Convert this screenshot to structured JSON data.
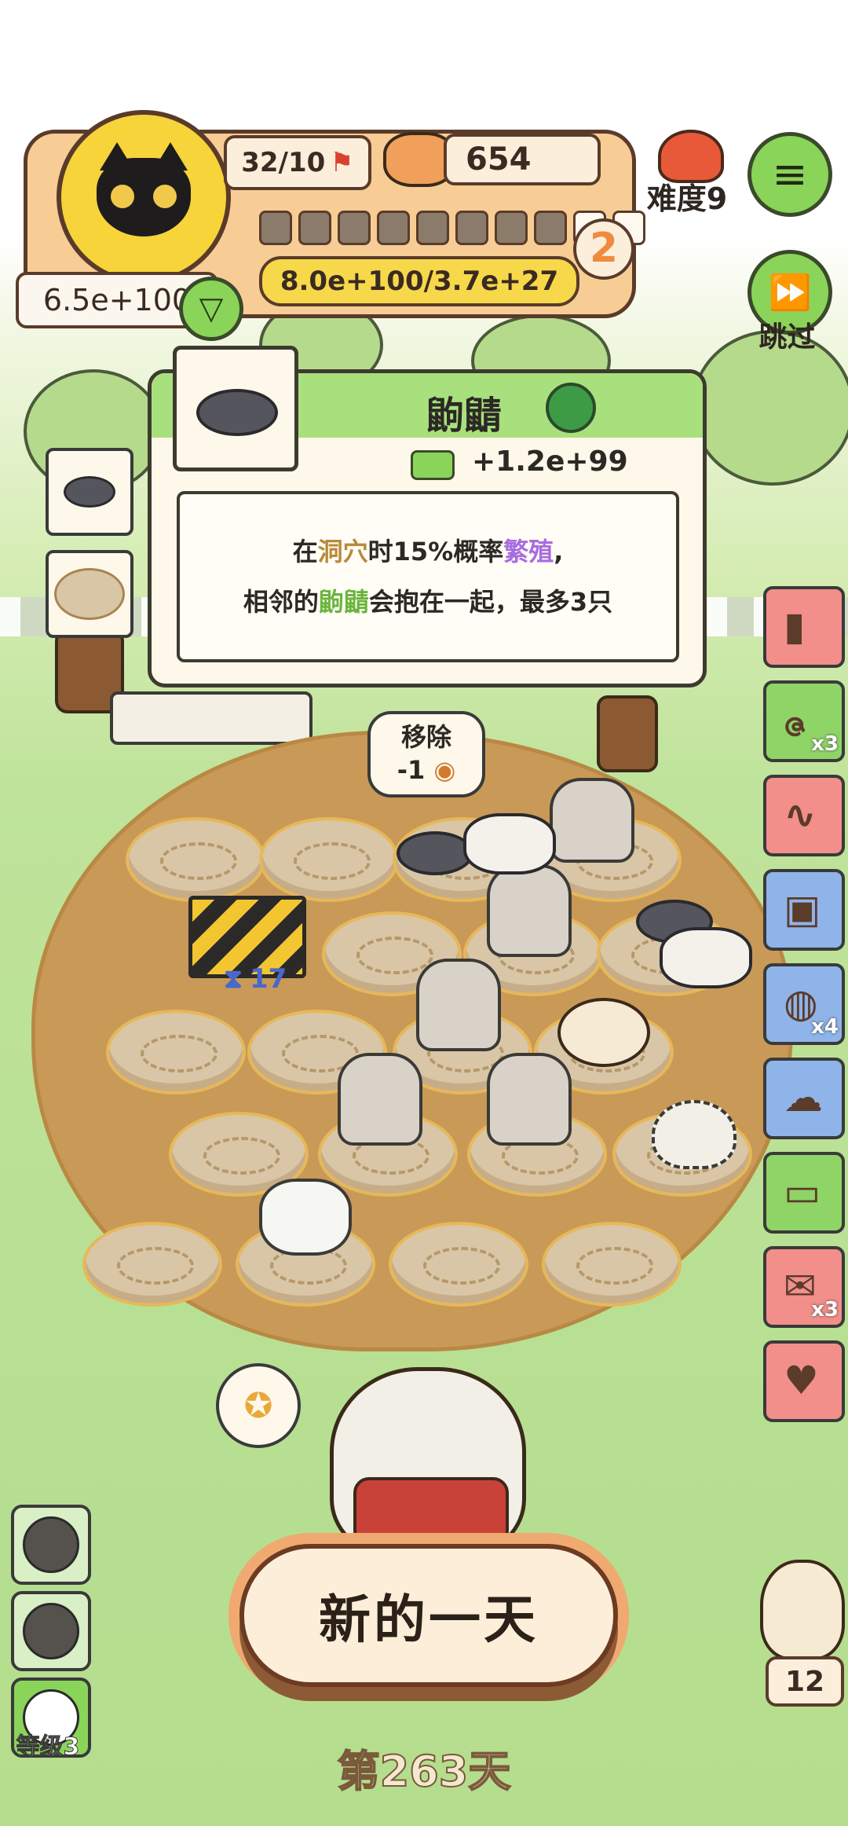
{
  "hud": {
    "capacity": "32/10",
    "food_count": "654",
    "difficulty_label": "难度9",
    "level_badge": "2",
    "score_progress": "8.0e+100/3.7e+27",
    "total_value": "6.5e+100",
    "progress_filled": 8,
    "progress_total": 10,
    "skip_label": "跳过"
  },
  "card": {
    "title": "鼩鼱",
    "income": "+1.2e+99",
    "desc_parts": [
      "在",
      "洞穴",
      "时15%概率",
      "繁殖",
      ","
    ],
    "desc_line2_parts": [
      "相邻的",
      "鼩鼱",
      "会抱在一起，最多3只"
    ]
  },
  "bubble": {
    "line1": "移除",
    "line2": "-1"
  },
  "barrier": {
    "timer": "17"
  },
  "side_items": [
    {
      "name": "bamboo-item",
      "count": "",
      "color": "#f28f8a",
      "glyph": "▮"
    },
    {
      "name": "worm-item",
      "count": "x3",
      "color": "#8fd466",
      "glyph": "ဇ"
    },
    {
      "name": "rope-item",
      "count": "",
      "color": "#f28f8a",
      "glyph": "∿"
    },
    {
      "name": "bag-item",
      "count": "",
      "color": "#8fb4ea",
      "glyph": "▣"
    },
    {
      "name": "sack-item",
      "count": "x4",
      "color": "#8fb4ea",
      "glyph": "◍"
    },
    {
      "name": "wool-item",
      "count": "",
      "color": "#8fb4ea",
      "glyph": "☁"
    },
    {
      "name": "card-item",
      "count": "",
      "color": "#8fd466",
      "glyph": "▭"
    },
    {
      "name": "scroll-item",
      "count": "x3",
      "color": "#f28f8a",
      "glyph": "✉"
    },
    {
      "name": "heart-item",
      "count": "",
      "color": "#f28f8a",
      "glyph": "♥"
    }
  ],
  "skills": {
    "level_label": "等级3"
  },
  "owl_count": "12",
  "main": {
    "new_day_label": "新的一天",
    "day_label": "第263天"
  },
  "colors": {
    "green_button": "#8bd45a",
    "panel": "#f7cd95",
    "dirt": "#c99958"
  }
}
